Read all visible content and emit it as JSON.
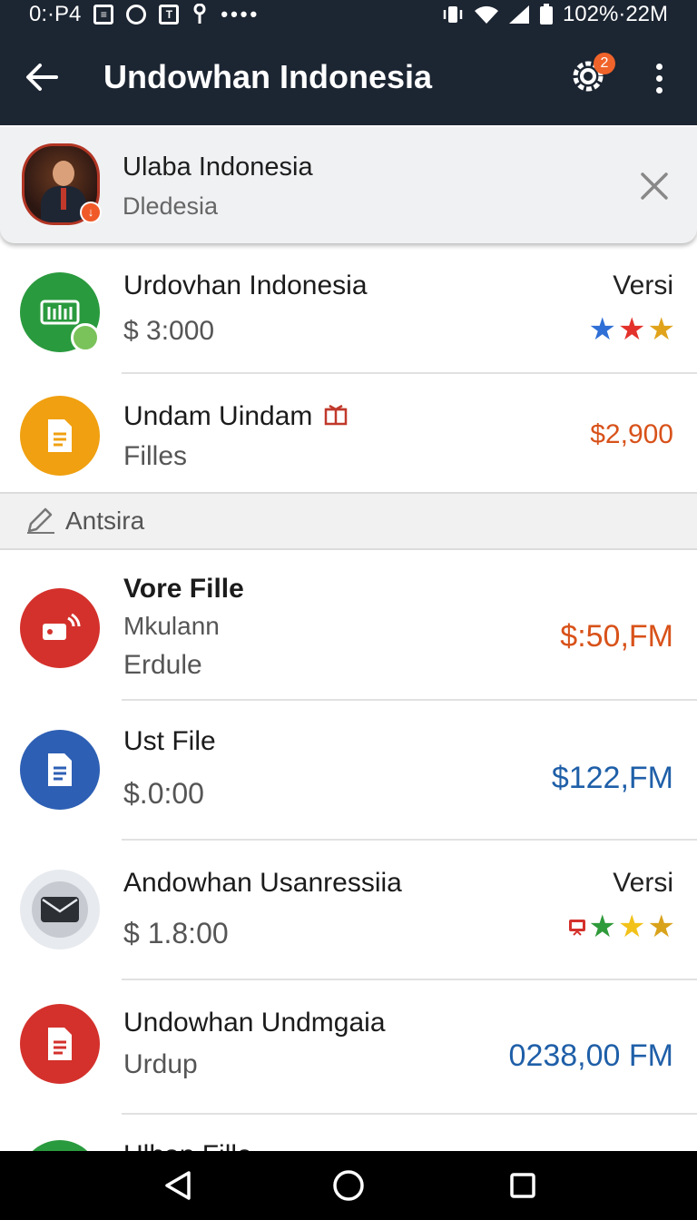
{
  "status_bar": {
    "left_text": "0:·P4",
    "right_text": "102%·22M",
    "icons": [
      "box-icon",
      "circle-icon",
      "box-icon",
      "key-icon",
      "more-dots-icon",
      "vibrate-icon",
      "wifi-icon",
      "signal-icon",
      "battery-icon"
    ]
  },
  "app_bar": {
    "title": "Undowhan Indonesia",
    "notification_badge": "2"
  },
  "notification": {
    "title": "Ulaba Indonesia",
    "subtitle": "Dledesia"
  },
  "items": [
    {
      "title": "Urdovhan Indonesia",
      "subtitle": "$ 3:000",
      "right_label": "Versi",
      "icon_color": "#2a9a3e",
      "icon": "chart-icon",
      "stars": [
        "#2f6fd6",
        "#e3322b",
        "#e0a31b"
      ]
    },
    {
      "title": "Undam Uindam",
      "subtitle": "Filles",
      "price": "$2,900",
      "price_color": "#d8521a",
      "icon_color": "#f0a010",
      "icon": "document-icon"
    }
  ],
  "section": {
    "label": "Antsira"
  },
  "files": [
    {
      "title": "Vore Fille",
      "subtitle": "Mkulann",
      "subtitle2": "Erdule",
      "price": "$:50,FM",
      "price_color": "#d8521a",
      "icon_color": "#d4312c",
      "icon": "music-icon"
    },
    {
      "title": "Ust File",
      "subtitle": "$.0:00",
      "price": "$122,FM",
      "price_color": "#1f5fa8",
      "icon_color": "#2d5fb4",
      "icon": "document-icon"
    },
    {
      "title": "Andowhan Usanressiia",
      "subtitle": "$ 1.8:00",
      "right_label": "Versi",
      "icon_color": "#e7eaee",
      "icon": "mail-icon",
      "stars": [
        "#2f9a3a",
        "#f2c21b",
        "#d9a21b"
      ]
    },
    {
      "title": "Undowhan Undmgaia",
      "subtitle": "Urdup",
      "price": "0238,00 FM",
      "price_color": "#1f5fa8",
      "icon_color": "#d4312c",
      "icon": "document-icon"
    },
    {
      "title": "Ulhan Fille",
      "icon_color": "#2a9a3e"
    }
  ]
}
